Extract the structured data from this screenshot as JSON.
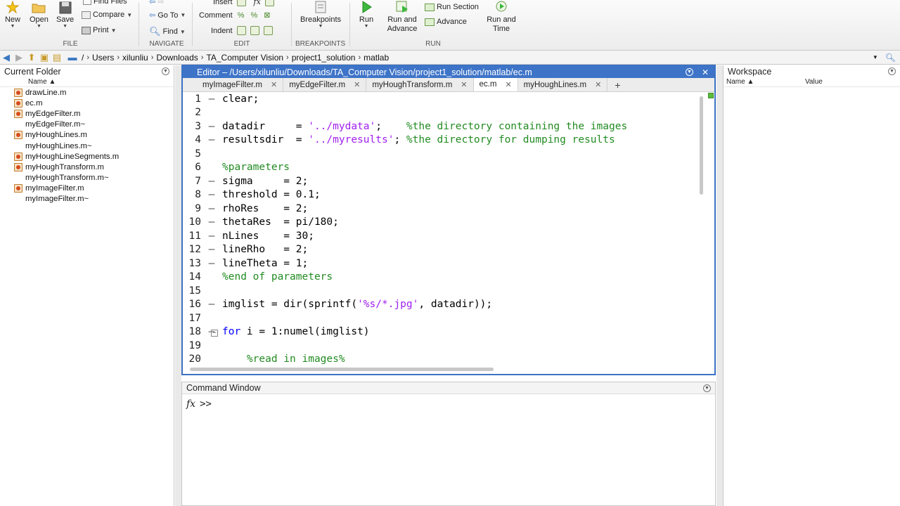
{
  "toolstrip": {
    "file": {
      "new": "New",
      "open": "Open",
      "save": "Save",
      "find_files": "Find Files",
      "compare": "Compare",
      "print": "Print",
      "section": "FILE"
    },
    "navigate": {
      "go_to": "Go To",
      "find": "Find",
      "section": "NAVIGATE"
    },
    "edit": {
      "insert": "Insert",
      "comment": "Comment",
      "indent": "Indent",
      "section": "EDIT"
    },
    "breakpoints": {
      "label": "Breakpoints",
      "section": "BREAKPOINTS"
    },
    "run": {
      "run": "Run",
      "run_and_advance": "Run and\nAdvance",
      "run_section": "Run Section",
      "advance": "Advance",
      "run_and_time": "Run and\nTime",
      "section": "RUN"
    }
  },
  "address": {
    "root": "/",
    "crumbs": [
      "Users",
      "xilunliu",
      "Downloads",
      "TA_Computer Vision",
      "project1_solution",
      "matlab"
    ]
  },
  "current_folder": {
    "title": "Current Folder",
    "column": "Name ▲",
    "files": [
      {
        "name": "drawLine.m",
        "type": "m"
      },
      {
        "name": "ec.m",
        "type": "m"
      },
      {
        "name": "myEdgeFilter.m",
        "type": "m"
      },
      {
        "name": "myEdgeFilter.m~",
        "type": "blank"
      },
      {
        "name": "myHoughLines.m",
        "type": "m"
      },
      {
        "name": "myHoughLines.m~",
        "type": "blank"
      },
      {
        "name": "myHoughLineSegments.m",
        "type": "m"
      },
      {
        "name": "myHoughTransform.m",
        "type": "m"
      },
      {
        "name": "myHoughTransform.m~",
        "type": "blank"
      },
      {
        "name": "myImageFilter.m",
        "type": "m"
      },
      {
        "name": "myImageFilter.m~",
        "type": "blank"
      }
    ]
  },
  "editor": {
    "title": "Editor – /Users/xilunliu/Downloads/TA_Computer Vision/project1_solution/matlab/ec.m",
    "tabs": [
      "myImageFilter.m",
      "myEdgeFilter.m",
      "myHoughTransform.m",
      "ec.m",
      "myHoughLines.m"
    ],
    "active_tab": "ec.m",
    "lines": [
      {
        "n": "1",
        "d": "–",
        "t": "clear;"
      },
      {
        "n": "2",
        "d": "",
        "t": ""
      },
      {
        "n": "3",
        "d": "–",
        "t": "datadir     = '../mydata';    %the directory containing the images"
      },
      {
        "n": "4",
        "d": "–",
        "t": "resultsdir  = '../myresults'; %the directory for dumping results"
      },
      {
        "n": "5",
        "d": "",
        "t": ""
      },
      {
        "n": "6",
        "d": "",
        "t": "%parameters"
      },
      {
        "n": "7",
        "d": "–",
        "t": "sigma     = 2;"
      },
      {
        "n": "8",
        "d": "–",
        "t": "threshold = 0.1;"
      },
      {
        "n": "9",
        "d": "–",
        "t": "rhoRes    = 2;"
      },
      {
        "n": "10",
        "d": "–",
        "t": "thetaRes  = pi/180;"
      },
      {
        "n": "11",
        "d": "–",
        "t": "nLines    = 30;"
      },
      {
        "n": "12",
        "d": "–",
        "t": "lineRho   = 2;"
      },
      {
        "n": "13",
        "d": "–",
        "t": "lineTheta = 1;"
      },
      {
        "n": "14",
        "d": "",
        "t": "%end of parameters"
      },
      {
        "n": "15",
        "d": "",
        "t": ""
      },
      {
        "n": "16",
        "d": "–",
        "t": "imglist = dir(sprintf('%s/*.jpg', datadir));"
      },
      {
        "n": "17",
        "d": "",
        "t": ""
      },
      {
        "n": "18",
        "d": "–",
        "t": "for i = 1:numel(imglist)"
      },
      {
        "n": "19",
        "d": "",
        "t": ""
      },
      {
        "n": "20",
        "d": "",
        "t": "    %read in images%"
      }
    ]
  },
  "command_window": {
    "title": "Command Window",
    "fx": "fx",
    "prompt": ">>"
  },
  "workspace": {
    "title": "Workspace",
    "col_name": "Name ▲",
    "col_value": "Value"
  },
  "colors": {
    "accent": "#3e74c8",
    "keyword": "#0000ff",
    "string": "#a020f0",
    "comment": "#228b22"
  }
}
